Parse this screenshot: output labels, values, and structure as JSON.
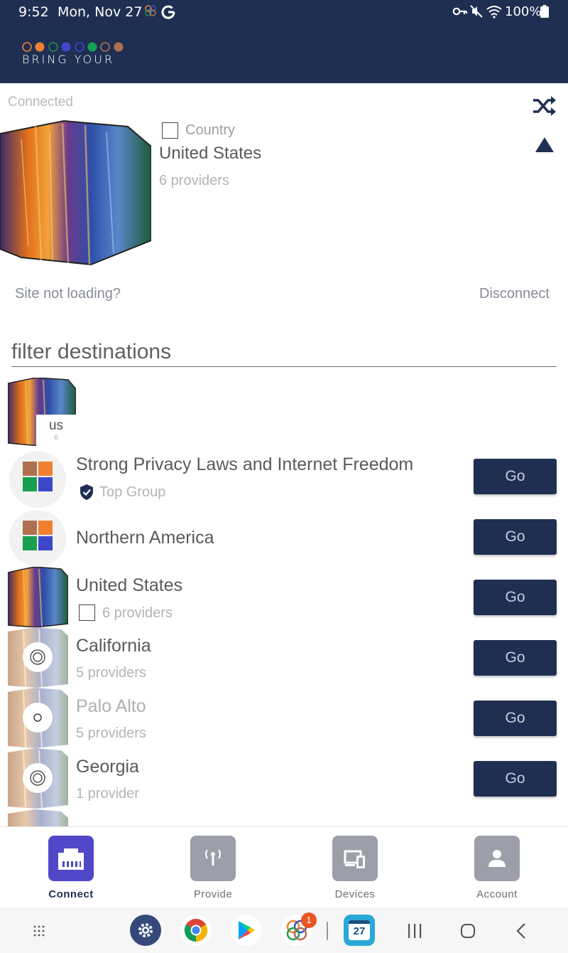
{
  "status_bar": {
    "time": "9:52",
    "date": "Mon, Nov 27",
    "battery": "100%"
  },
  "app": {
    "logo_text": "BRING YOUR",
    "logo_dot_colors": [
      "#f08030",
      "#1e8a50",
      "#3d48c8",
      "#1e8a50",
      "#18a050",
      "#b07050"
    ]
  },
  "connection": {
    "status": "Connected",
    "type_label": "Country",
    "location": "United States",
    "providers": "6 providers",
    "help_link": "Site not loading?",
    "disconnect": "Disconnect"
  },
  "filter": {
    "placeholder": "filter destinations"
  },
  "quick_pick": {
    "code": "us",
    "count": "6"
  },
  "destinations": [
    {
      "title": "Strong Privacy Laws and Internet Freedom",
      "subtitle": "Top Group",
      "action": "Go",
      "icon": "grid-icon"
    },
    {
      "title": "Northern America",
      "subtitle": "",
      "action": "Go",
      "icon": "grid-icon"
    },
    {
      "title": "United States",
      "subtitle": "6 providers",
      "action": "Go",
      "icon": "country-image"
    },
    {
      "title": "California",
      "subtitle": "5 providers",
      "action": "Go",
      "icon": "region-icon"
    },
    {
      "title": "Palo Alto",
      "subtitle": "5 providers",
      "action": "Go",
      "icon": "city-icon"
    },
    {
      "title": "Georgia",
      "subtitle": "1 provider",
      "action": "Go",
      "icon": "region-icon"
    }
  ],
  "bottom_nav": [
    {
      "label": "Connect",
      "active": true
    },
    {
      "label": "Provide",
      "active": false
    },
    {
      "label": "Devices",
      "active": false
    },
    {
      "label": "Account",
      "active": false
    }
  ],
  "system_bar": {
    "calendar_day": "27",
    "notification_badge": "1"
  },
  "colors": {
    "navy": "#1f2f52",
    "accent": "#5048c8",
    "muted": "#b4b4b4"
  }
}
